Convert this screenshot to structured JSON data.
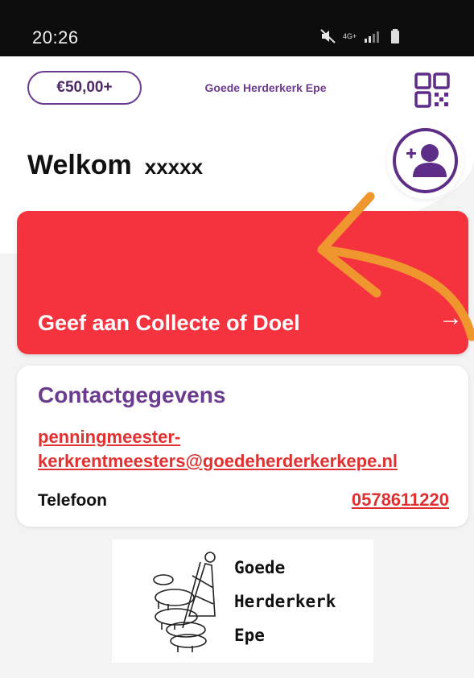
{
  "status_bar": {
    "time": "20:26",
    "network": "4G+",
    "icons": [
      "mute-icon",
      "signal-icon",
      "battery-icon"
    ]
  },
  "header": {
    "amount": "€50,00+",
    "church_name": "Goede Herderkerk Epe",
    "qr_icon": "qr-code-icon"
  },
  "welcome": {
    "greeting": "Welkom",
    "name": "xxxxx",
    "add_user_icon": "add-user-icon"
  },
  "give_card": {
    "label": "Geef aan Collecte of Doel",
    "arrow": "→"
  },
  "contact": {
    "title": "Contactgegevens",
    "email_line1": "penningmeester-",
    "email_line2": "kerkrentmeesters@goedeherderkerkepe.nl",
    "phone_label": "Telefoon",
    "phone": "0578611220"
  },
  "logo": {
    "line1": "Goede",
    "line2": "Herderkerk",
    "line3": "Epe"
  },
  "colors": {
    "purple": "#6a3b8e",
    "red_card": "#f5333f",
    "link_red": "#e03030",
    "annotation_orange": "#f0962e"
  }
}
